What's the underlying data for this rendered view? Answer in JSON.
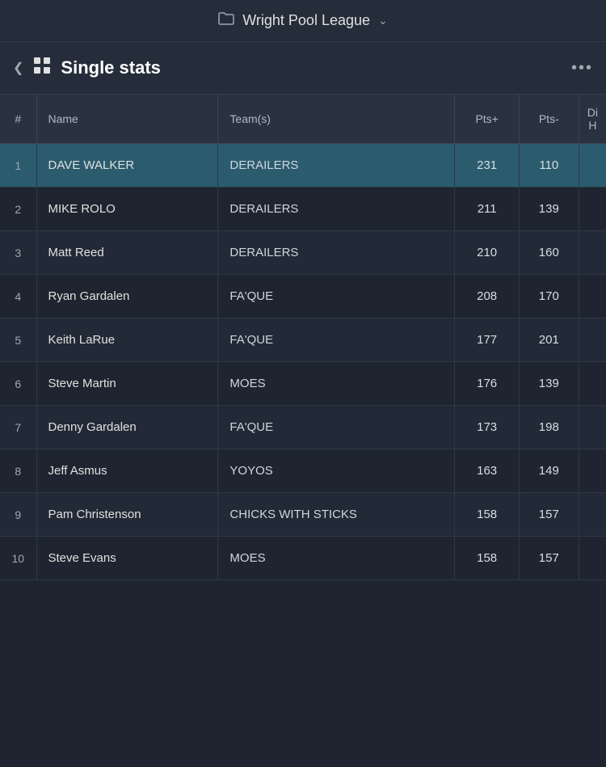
{
  "topbar": {
    "title": "Wright Pool League",
    "folder_icon": "🗀",
    "chevron": "⌄"
  },
  "section": {
    "title": "Single stats",
    "collapse_label": "‹",
    "grid_icon": "⊞",
    "more_label": "•••"
  },
  "table": {
    "columns": [
      {
        "key": "#",
        "label": "#"
      },
      {
        "key": "name",
        "label": "Name"
      },
      {
        "key": "teams",
        "label": "Team(s)"
      },
      {
        "key": "pts_plus",
        "label": "Pts+"
      },
      {
        "key": "pts_minus",
        "label": "Pts-"
      },
      {
        "key": "di",
        "label": "Di..."
      }
    ],
    "rows": [
      {
        "rank": "1",
        "name": "DAVE WALKER",
        "teams": "DERAILERS",
        "pts_plus": "231",
        "pts_minus": "110",
        "highlighted": true
      },
      {
        "rank": "2",
        "name": "MIKE ROLO",
        "teams": "DERAILERS",
        "pts_plus": "211",
        "pts_minus": "139",
        "highlighted": false
      },
      {
        "rank": "3",
        "name": "Matt Reed",
        "teams": "DERAILERS",
        "pts_plus": "210",
        "pts_minus": "160",
        "highlighted": false
      },
      {
        "rank": "4",
        "name": "Ryan Gardalen",
        "teams": "FA'QUE",
        "pts_plus": "208",
        "pts_minus": "170",
        "highlighted": false
      },
      {
        "rank": "5",
        "name": "Keith LaRue",
        "teams": "FA'QUE",
        "pts_plus": "177",
        "pts_minus": "201",
        "highlighted": false
      },
      {
        "rank": "6",
        "name": "Steve Martin",
        "teams": "MOES",
        "pts_plus": "176",
        "pts_minus": "139",
        "highlighted": false
      },
      {
        "rank": "7",
        "name": "Denny Gardalen",
        "teams": "FA'QUE",
        "pts_plus": "173",
        "pts_minus": "198",
        "highlighted": false
      },
      {
        "rank": "8",
        "name": "Jeff Asmus",
        "teams": "YOYOS",
        "pts_plus": "163",
        "pts_minus": "149",
        "highlighted": false
      },
      {
        "rank": "9",
        "name": "Pam Christenson",
        "teams": "CHICKS WITH STICKS",
        "pts_plus": "158",
        "pts_minus": "157",
        "highlighted": false
      },
      {
        "rank": "10",
        "name": "Steve Evans",
        "teams": "MOES",
        "pts_plus": "158",
        "pts_minus": "157",
        "highlighted": false
      }
    ]
  }
}
